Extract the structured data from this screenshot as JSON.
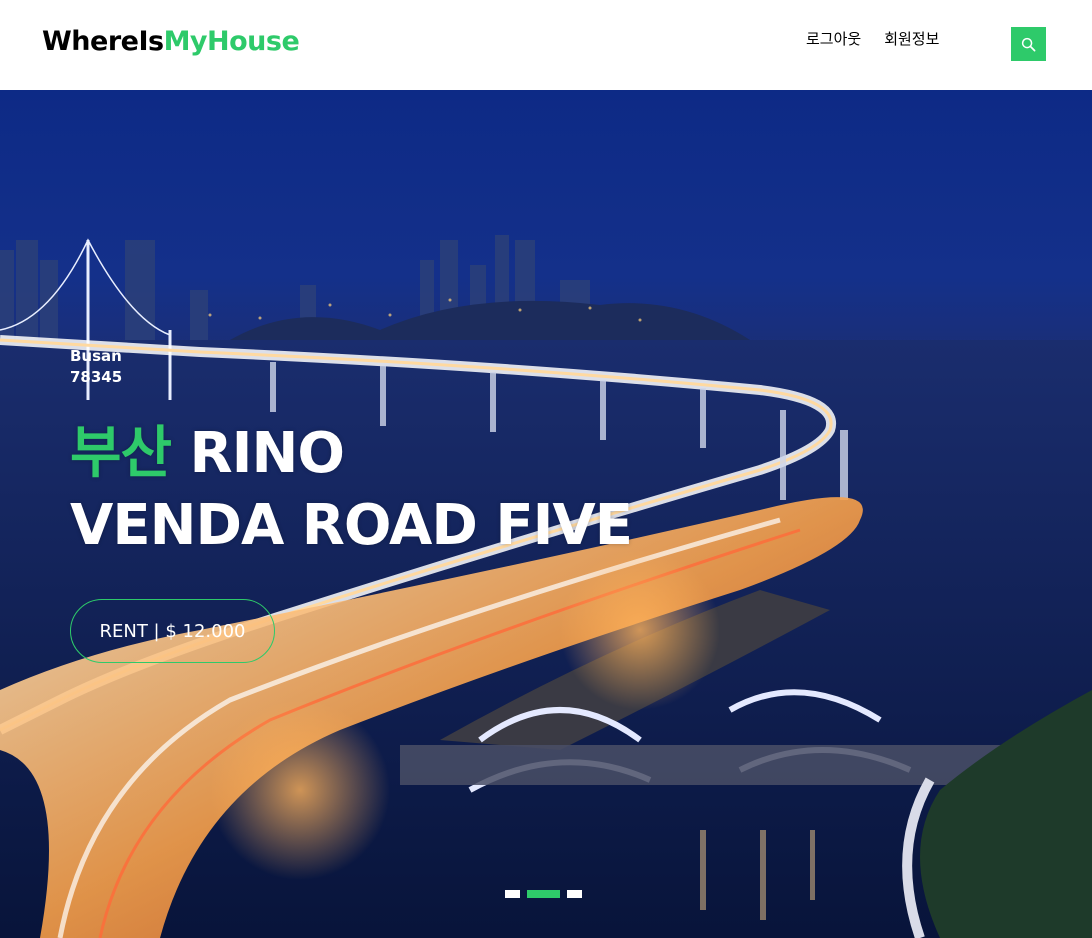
{
  "header": {
    "brand_part1": "WhereIs",
    "brand_part2": "MyHouse",
    "nav": [
      {
        "label": "로그아웃"
      },
      {
        "label": "회원정보"
      }
    ],
    "search_icon": "search-icon"
  },
  "hero": {
    "location_line1": "Busan",
    "location_line2": "78345",
    "title_accent": "부산",
    "title_rest_line1": " RINO",
    "title_line2": "VENDA ROAD FIVE",
    "price_label": "RENT | $ 12.000",
    "carousel": {
      "count": 3,
      "active": 2
    }
  },
  "colors": {
    "accent": "#2eca6a",
    "text": "#000000",
    "hero_sky": "#14308a"
  }
}
